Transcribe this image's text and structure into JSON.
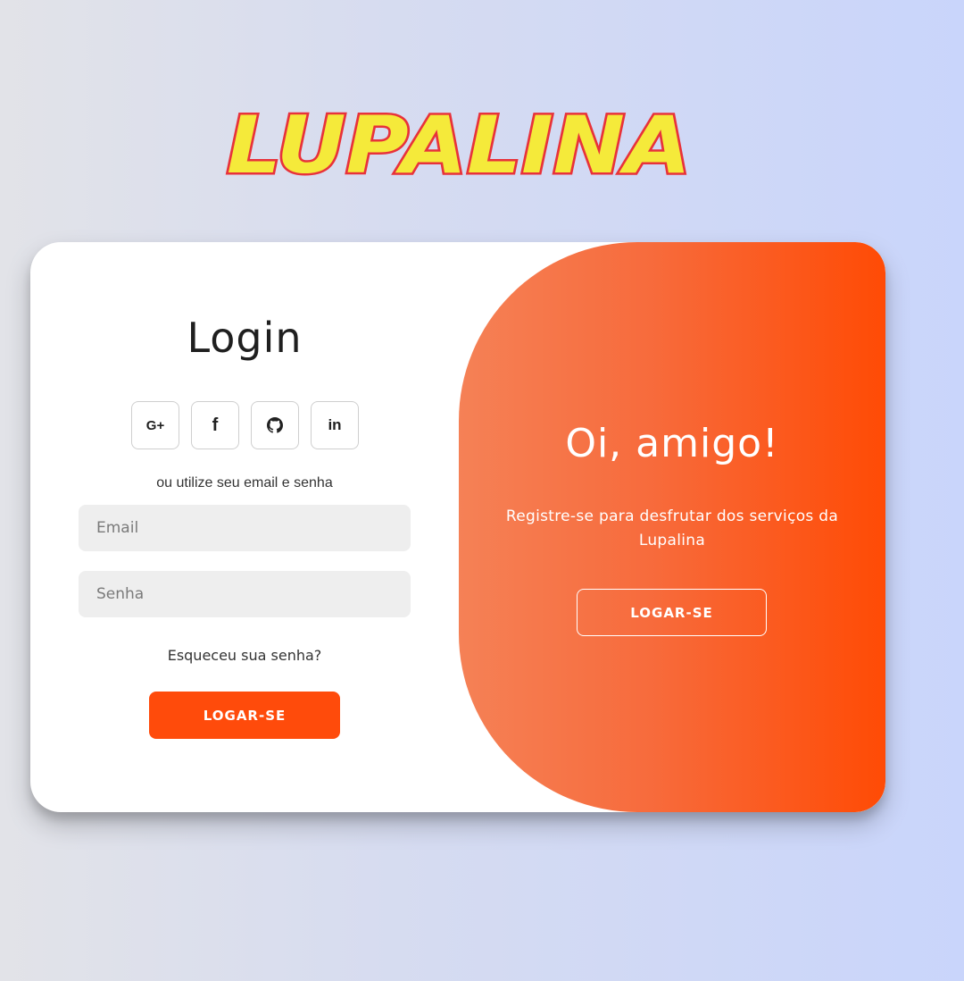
{
  "brand": {
    "logo_text": "LUPALINA",
    "logo_fill": "#f5ea3a",
    "logo_stroke": "#e8323a"
  },
  "login": {
    "title": "Login",
    "social": [
      {
        "icon": "google-plus-icon",
        "label": "G+"
      },
      {
        "icon": "facebook-icon",
        "label": "f"
      },
      {
        "icon": "github-icon"
      },
      {
        "icon": "linkedin-icon",
        "label": "in"
      }
    ],
    "alt_text": "ou utilize seu email e senha",
    "email_placeholder": "Email",
    "password_placeholder": "Senha",
    "forgot_password": "Esqueceu sua senha?",
    "submit_label": "LOGAR-SE"
  },
  "overlay": {
    "title": "Oi, amigo!",
    "text": "Registre-se para desfrutar dos serviços da Lupalina",
    "button_label": "LOGAR-SE"
  },
  "colors": {
    "accent": "#ff4b0b",
    "overlay_start": "#f58156",
    "overlay_end": "#ff4b05"
  }
}
